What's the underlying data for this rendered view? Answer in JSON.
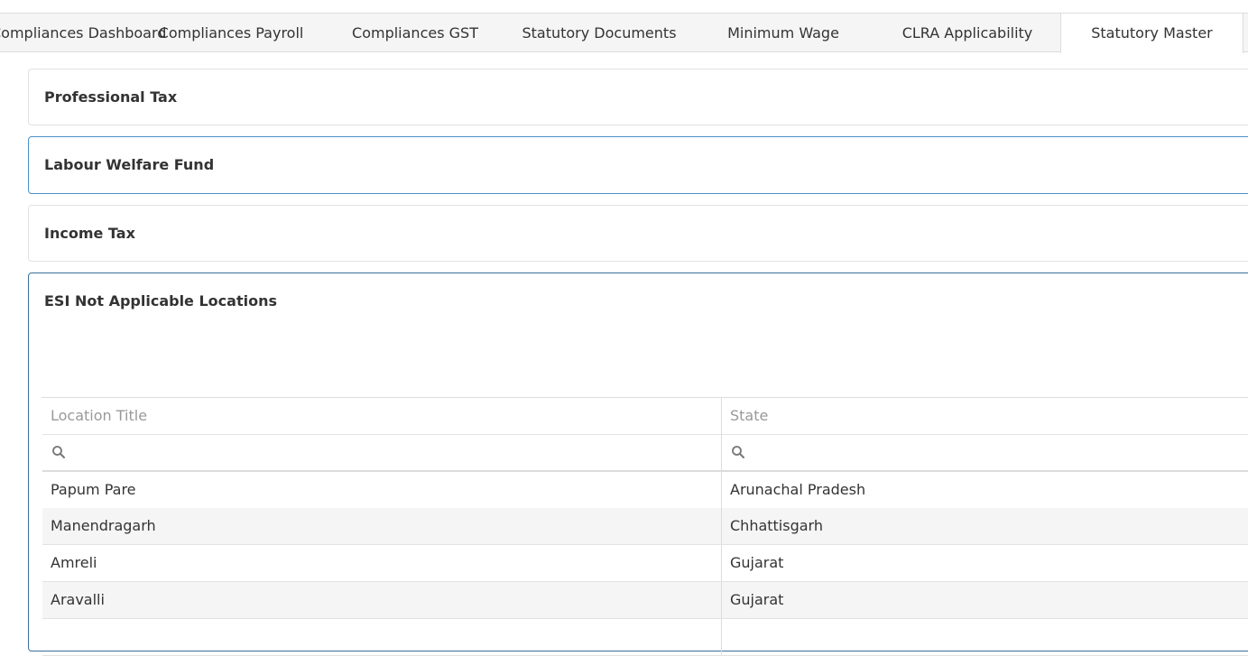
{
  "tabs": [
    {
      "label": "Compliances Dashboard",
      "active": false
    },
    {
      "label": "Compliances Payroll",
      "active": false
    },
    {
      "label": "Compliances GST",
      "active": false
    },
    {
      "label": "Statutory Documents",
      "active": false
    },
    {
      "label": "Minimum Wage",
      "active": false
    },
    {
      "label": "CLRA Applicability",
      "active": false
    },
    {
      "label": "Statutory Master",
      "active": true
    }
  ],
  "panels": {
    "professional_tax": "Professional Tax",
    "labour_welfare_fund": "Labour Welfare Fund",
    "income_tax": "Income Tax",
    "esi_not_applicable": "ESI Not Applicable Locations"
  },
  "grid": {
    "columns": [
      "Location Title",
      "State"
    ],
    "rows": [
      {
        "location": "Papum Pare",
        "state": "Arunachal Pradesh"
      },
      {
        "location": "Manendragarh",
        "state": "Chhattisgarh"
      },
      {
        "location": "Amreli",
        "state": "Gujarat"
      },
      {
        "location": "Aravalli",
        "state": "Gujarat"
      }
    ]
  },
  "icons": {
    "filter": "search-icon"
  }
}
